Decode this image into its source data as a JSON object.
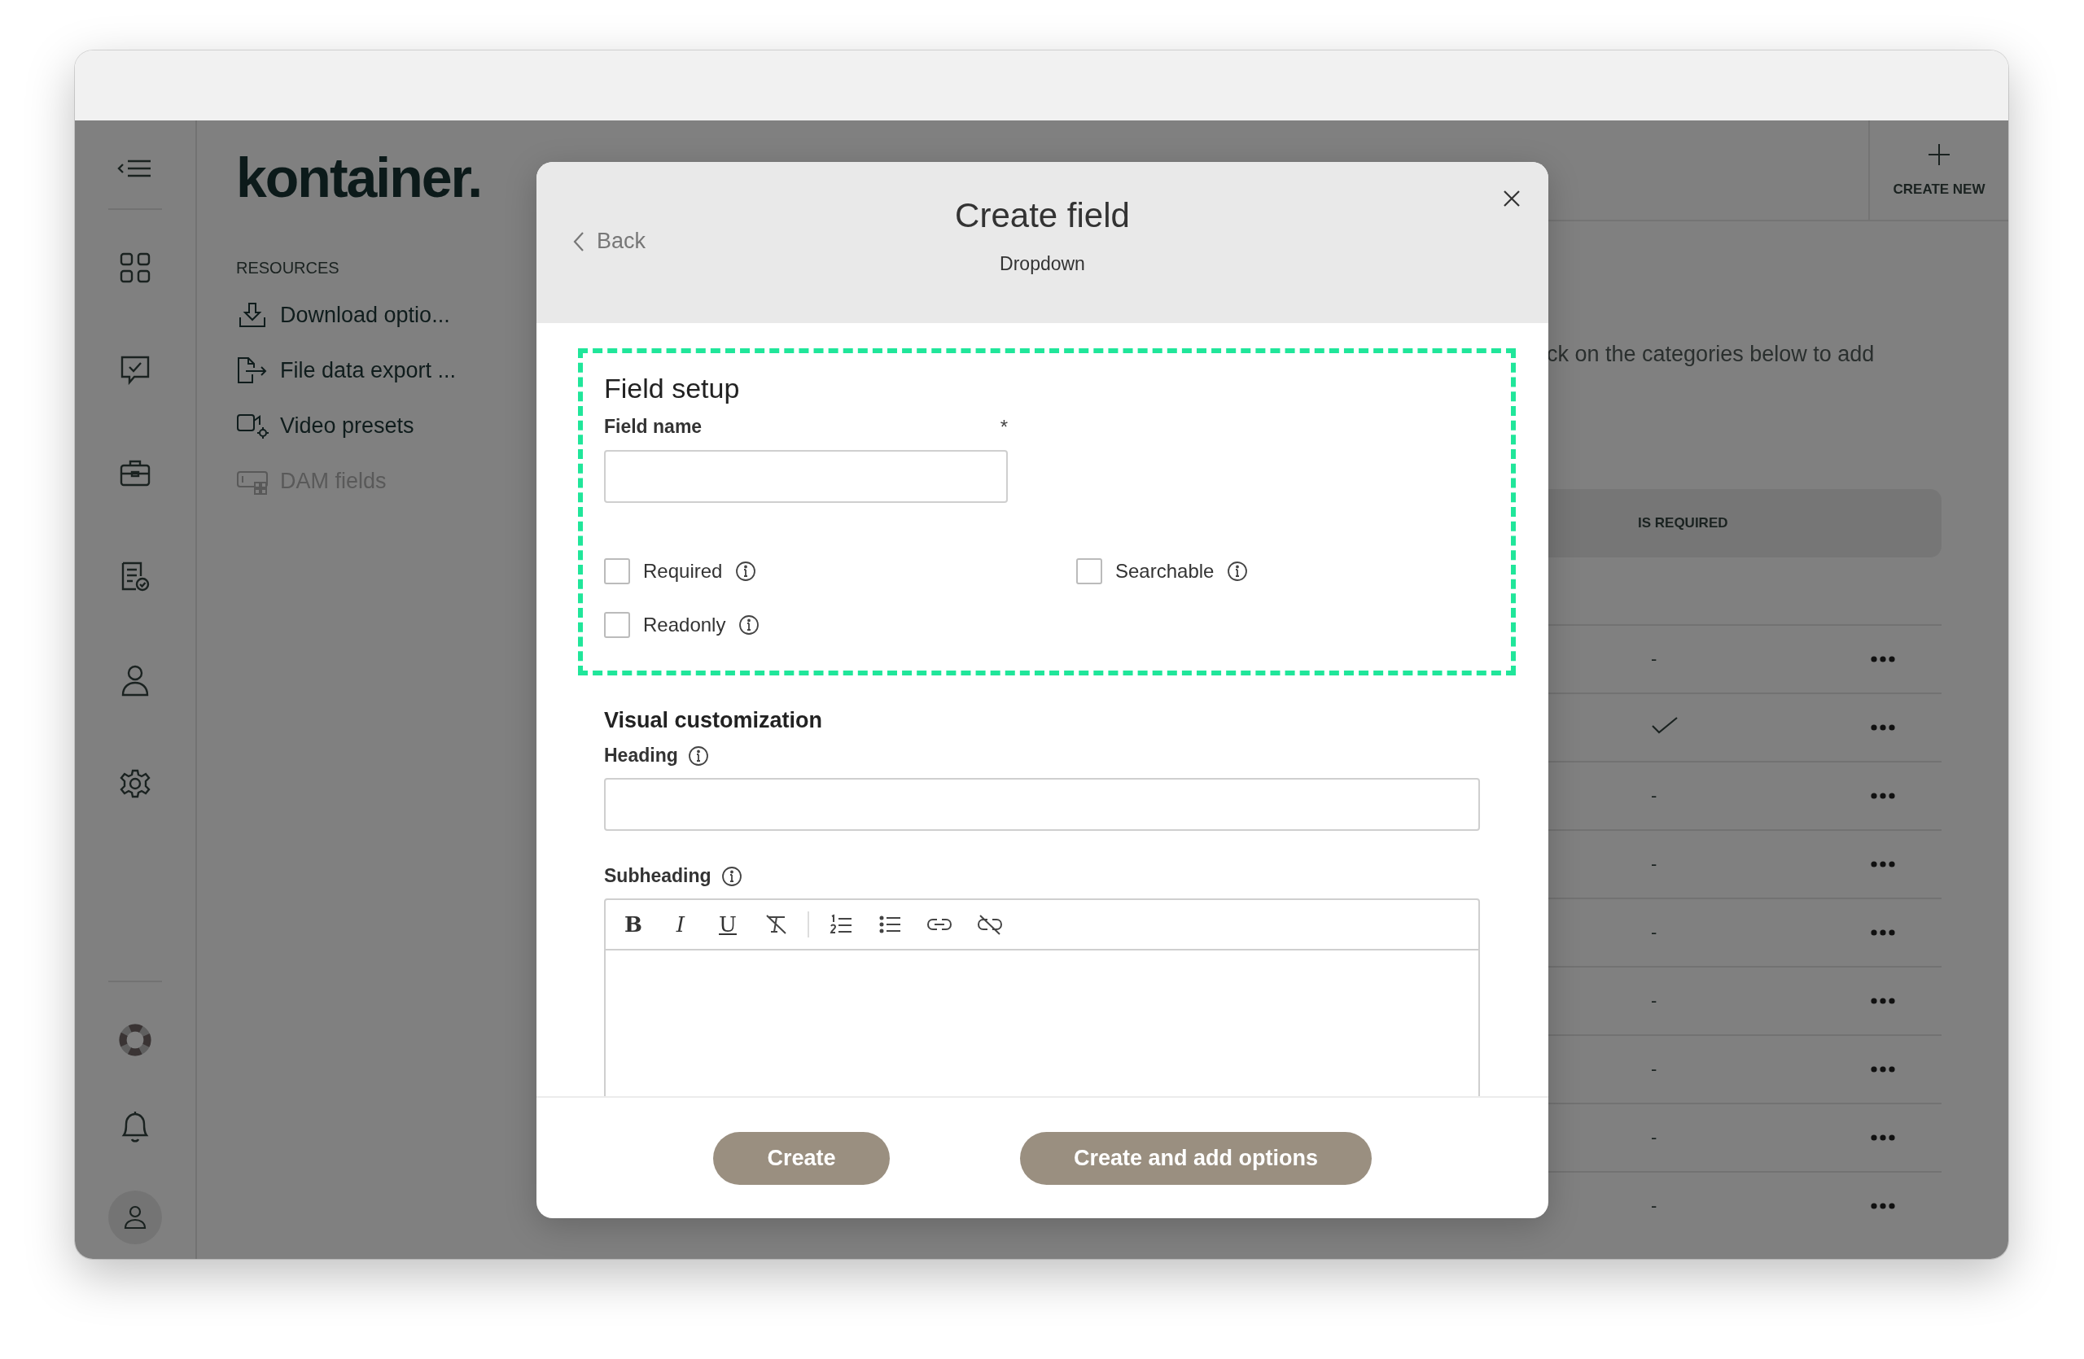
{
  "logo": "kontainer.",
  "sidebar": {
    "heading": "RESOURCES",
    "items": [
      {
        "kind": "download",
        "label": "Download optio...",
        "selected": false
      },
      {
        "kind": "export",
        "label": "File data export ...",
        "selected": false
      },
      {
        "kind": "video",
        "label": "Video presets",
        "selected": false
      },
      {
        "kind": "fields",
        "label": "DAM fields",
        "selected": true
      }
    ]
  },
  "header": {
    "create_button": "CREATE NEW"
  },
  "content": {
    "hint": "ck on the categories below to add",
    "table": {
      "columns": [
        "IS REQUIRED"
      ],
      "rows": [
        {
          "required": false,
          "value": "-"
        },
        {
          "required": true
        },
        {
          "required": false,
          "value": "-"
        },
        {
          "required": false,
          "value": "-"
        },
        {
          "required": false,
          "value": "-"
        },
        {
          "required": false,
          "value": "-"
        },
        {
          "required": false,
          "value": "-"
        },
        {
          "required": false,
          "value": "-"
        },
        {
          "required": false,
          "value": "-"
        }
      ]
    }
  },
  "modal": {
    "back": "Back",
    "title": "Create field",
    "subtitle": "Dropdown",
    "field_setup": {
      "heading": "Field setup",
      "name_label": "Field name",
      "required_mark": "*",
      "options": [
        {
          "label": "Required",
          "checked": false
        },
        {
          "label": "Searchable",
          "checked": false
        },
        {
          "label": "Readonly",
          "checked": false
        }
      ]
    },
    "visual": {
      "heading": "Visual customization",
      "heading_label": "Heading",
      "subheading_label": "Subheading",
      "toolbar": [
        {
          "kind": "bold",
          "glyph": "B"
        },
        {
          "kind": "italic",
          "glyph": "I"
        },
        {
          "kind": "underline",
          "glyph": "U"
        },
        {
          "kind": "clear-format"
        },
        {
          "kind": "ordered-list"
        },
        {
          "kind": "bullet-list"
        },
        {
          "kind": "link"
        },
        {
          "kind": "unlink"
        }
      ]
    },
    "buttons": [
      "Create",
      "Create and add options"
    ]
  }
}
